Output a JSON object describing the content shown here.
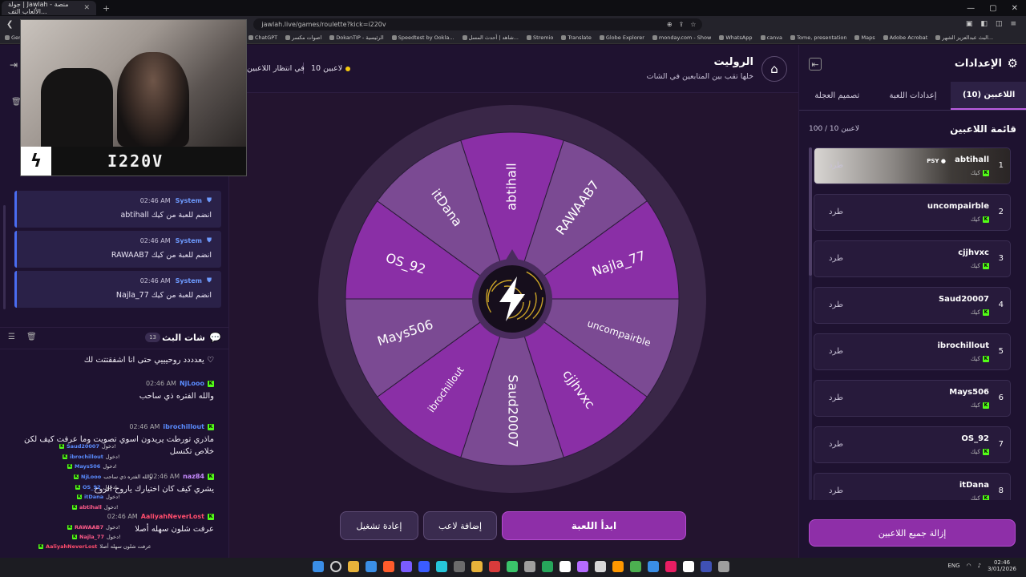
{
  "browser": {
    "tab_title": "جولة | Jawlah - منصة الألعاب التف...",
    "url": "jawlah.live/games/roulette?kick=i220v",
    "bookmarks": [
      "Gen",
      "ChatGPT",
      "اصوات مكسر",
      "DokanTIP - الرئيسية",
      "Speedtest by Ookla...",
      "شاهد | أحدث المسل...",
      "Stremio",
      "Translate",
      "Globe Explorer",
      "monday.com - Show",
      "WhatsApp",
      "canva",
      "Tome, presentation",
      "Maps",
      "Adobe Acrobat",
      "البث عبدالعزيز الشهر..."
    ]
  },
  "webcam": {
    "streamer_name": "I220V"
  },
  "system_messages": [
    {
      "sender": "System",
      "time": "02:46 AM",
      "text": "abtihall انضم للعبة من كيك"
    },
    {
      "sender": "System",
      "time": "02:46 AM",
      "text": "RAWAAB7 انضم للعبة من كيك"
    },
    {
      "sender": "System",
      "time": "02:46 AM",
      "text": "Najla_77 انضم للعبة من كيك"
    }
  ],
  "chat": {
    "title": "شات البث",
    "count": "13",
    "messages": [
      {
        "user": "",
        "time": "",
        "text": "يعدددد روحيييي حتى انا اشفقتتت لك ♡",
        "color": "#ffffff"
      },
      {
        "user": "NjLooo",
        "time": "02:46 AM",
        "text": "والله الفتره ذي ساحب",
        "color": "#5a8cff"
      },
      {
        "user": "ibrochillout",
        "time": "02:46 AM",
        "text": "ماذري تورطت يريدون اسوي تصويت وما عرفت كيف لكن خلاص تكنسل",
        "color": "#5a8cff"
      },
      {
        "user": "naz84",
        "time": "02:46 AM",
        "text": "يشري كيف كان اختيارك ياروح الروح",
        "color": "#c78bff"
      },
      {
        "user": "AaliyahNeverLost",
        "time": "02:46 AM",
        "text": "عرفت شلون سهله أصلا",
        "color": "#ff4d6d"
      }
    ],
    "overlay_lines": [
      {
        "user": "Saud20007",
        "text": "دخول!",
        "color": "#5a8cff"
      },
      {
        "user": "ibrochillout",
        "text": "دخول!",
        "color": "#5a8cff"
      },
      {
        "user": "Mays506",
        "text": "دخول!",
        "color": "#5a8cff"
      },
      {
        "user": "NjLooo",
        "text": "والله الفتره ذي ساحب",
        "color": "#5a8cff"
      },
      {
        "user": "OS_92",
        "text": "دخول!",
        "color": "#5a8cff"
      },
      {
        "user": "itDana",
        "text": "دخول!",
        "color": "#5a8cff"
      },
      {
        "user": "abtihall",
        "text": "دخول!",
        "color": "#ff5c8a"
      },
      {
        "user": "RAWAAB7",
        "text": "دخول!",
        "color": "#ff5c8a"
      },
      {
        "user": "Najla_77",
        "text": "دخول!",
        "color": "#ff5c8a"
      },
      {
        "user": "AaliyahNeverLost",
        "text": "عرفت شلون سهله أصلا",
        "color": "#ff4d6d"
      }
    ]
  },
  "game": {
    "title": "الروليت",
    "subtitle": "خلها تقب بين المتابعين في الشات",
    "players_count": "10 لاعبين",
    "status": "في انتظار اللاعبين",
    "wheel_segments": [
      "abtihall",
      "RAWAAB7",
      "Najla_77",
      "uncompairble",
      "cjjhvxc",
      "Saud20007",
      "ibrochillout",
      "Mays506",
      "OS_92",
      "itDana"
    ],
    "colors": {
      "dark": "#8a2fa6",
      "light": "#7b4a93",
      "rim": "#3a2748",
      "hub": "#160e1c"
    },
    "buttons": {
      "start": "ابدأ اللعبة",
      "add_player": "إضافة لاعب",
      "reset": "إعادة تشغيل"
    }
  },
  "settings": {
    "title": "الإعدادات",
    "tabs": [
      "اللاعبين (10)",
      "إعدادات اللعبة",
      "تصميم العجلة"
    ],
    "list_title": "قائمة اللاعبين",
    "capacity": "100 / 10 لاعبين",
    "players": [
      {
        "num": "1",
        "name": "abtihall",
        "source": "كيك",
        "badge": "PSY ●"
      },
      {
        "num": "2",
        "name": "uncompairble",
        "source": "كيك",
        "badge": ""
      },
      {
        "num": "3",
        "name": "cjjhvxc",
        "source": "كيك",
        "badge": ""
      },
      {
        "num": "4",
        "name": "Saud20007",
        "source": "كيك",
        "badge": ""
      },
      {
        "num": "5",
        "name": "ibrochillout",
        "source": "كيك",
        "badge": ""
      },
      {
        "num": "6",
        "name": "Mays506",
        "source": "كيك",
        "badge": ""
      },
      {
        "num": "7",
        "name": "OS_92",
        "source": "كيك",
        "badge": ""
      },
      {
        "num": "8",
        "name": "itDana",
        "source": "كيك",
        "badge": ""
      }
    ],
    "kick_label": "طرد",
    "remove_all": "إزالة جميع اللاعبين"
  },
  "taskbar": {
    "lang": "ENG",
    "time": "02:46",
    "date": "3/01/2026"
  }
}
